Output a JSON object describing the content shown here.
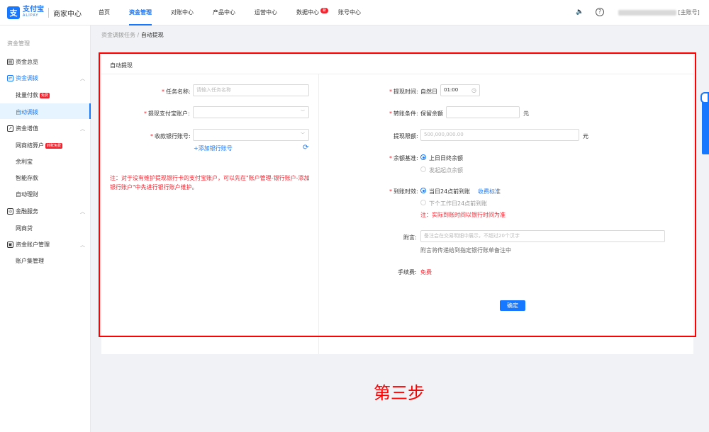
{
  "header": {
    "logo_mark": "支",
    "logo_cn": "支付宝",
    "logo_en": "ALIPAY",
    "logo_sub": "商家中心",
    "nav": [
      {
        "label": "首页",
        "active": false
      },
      {
        "label": "资金管理",
        "active": true
      },
      {
        "label": "对账中心",
        "active": false
      },
      {
        "label": "产品中心",
        "active": false
      },
      {
        "label": "运营中心",
        "active": false
      },
      {
        "label": "数据中心",
        "active": false,
        "badge": "新"
      },
      {
        "label": "账号中心",
        "active": false
      }
    ],
    "sound_icon": "🔈",
    "help_icon": "?",
    "account_suffix": "[主账号]"
  },
  "sidebar": {
    "title": "资金管理",
    "groups": [
      {
        "label": "资金总览",
        "icon": "overview-icon",
        "glyph": "▤"
      },
      {
        "label": "资金调拨",
        "icon": "transfer-icon",
        "glyph": "⇄",
        "active": true,
        "chevron": "︿",
        "items": [
          {
            "label": "批量付款",
            "badge": "免费"
          },
          {
            "label": "自动调拨",
            "active": true
          }
        ]
      },
      {
        "label": "资金增值",
        "icon": "chart-icon",
        "glyph": "↗",
        "chevron": "︿",
        "items": [
          {
            "label": "网商结算户",
            "badge": "转账免费"
          },
          {
            "label": "余利宝"
          },
          {
            "label": "智能存款"
          },
          {
            "label": "自动理财"
          }
        ]
      },
      {
        "label": "金融服务",
        "icon": "finance-icon",
        "glyph": "◎",
        "chevron": "︿",
        "items": [
          {
            "label": "网商贷"
          }
        ]
      },
      {
        "label": "资金账户管理",
        "icon": "account-icon",
        "glyph": "▣",
        "chevron": "︿",
        "items": [
          {
            "label": "账户集管理"
          }
        ]
      }
    ]
  },
  "breadcrumb": {
    "parent": "资金调拨任务",
    "sep": "/",
    "current": "自动提现"
  },
  "card": {
    "title": "自动提现"
  },
  "left_form": {
    "task_name_label": "任务名称:",
    "task_name_placeholder": "请输入任务名称",
    "alipay_account_label": "提现支付宝账户:",
    "bank_account_label": "收款银行账号:",
    "add_bank_link": "+添加银行账号",
    "note": "注：对于没有维护提现银行卡的支付宝账户，可以先在\"账户管理-银行账户-添加银行账户\"中先进行银行账户维护。"
  },
  "right_form": {
    "withdraw_time_label": "提现时间:",
    "withdraw_time_prefix": "自然日",
    "withdraw_time_value": "01:00",
    "transfer_cond_label": "转账条件:",
    "transfer_cond_prefix": "保留余额",
    "unit": "元",
    "limit_label": "提现限额:",
    "limit_placeholder": "500,000,000.00",
    "balance_base_label": "余额基准:",
    "balance_options": [
      "上日日终余额",
      "发起起点余额"
    ],
    "arrival_label": "到账时效:",
    "arrival_options": [
      "当日24点前到账",
      "下个工作日24点前到账"
    ],
    "fee_standard_link": "收费标准",
    "arrival_note": "注：实际到账时间以银行时间为准",
    "remark_label": "附言:",
    "remark_placeholder": "备注会在交易明细中展示，不超过20个汉字",
    "remark_hint": "附言将传递给到指定银行账单备注中",
    "fee_label": "手续费:",
    "fee_value": "免费",
    "confirm_button": "确定"
  },
  "step_label": "第三步",
  "colors": {
    "primary": "#1677ff",
    "danger": "#f5222d",
    "frame": "#ff0000"
  }
}
